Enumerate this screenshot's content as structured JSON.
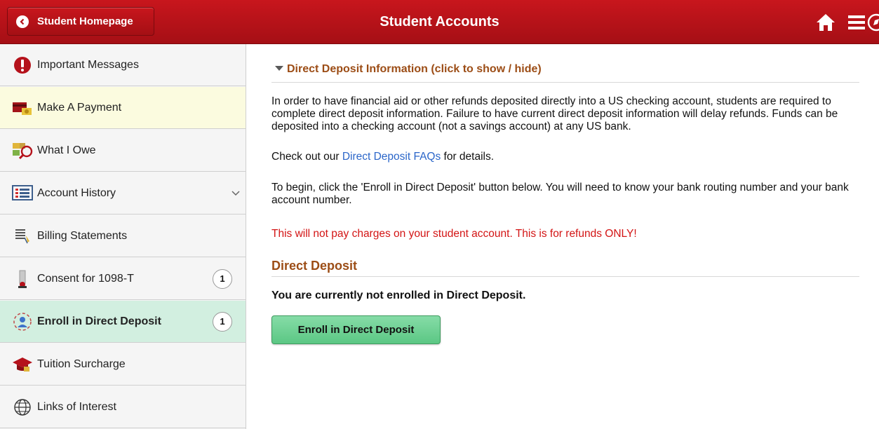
{
  "header": {
    "back_label": "Student Homepage",
    "title": "Student Accounts"
  },
  "sidebar": {
    "items": [
      {
        "label": "Important Messages",
        "icon": "alert-icon"
      },
      {
        "label": "Make A Payment",
        "icon": "payment-icon"
      },
      {
        "label": "What I Owe",
        "icon": "owe-icon"
      },
      {
        "label": "Account History",
        "icon": "history-icon"
      },
      {
        "label": "Billing Statements",
        "icon": "statement-icon"
      },
      {
        "label": "Consent for 1098-T",
        "icon": "consent-icon",
        "badge": "1"
      },
      {
        "label": "Enroll in Direct Deposit",
        "icon": "direct-deposit-icon",
        "badge": "1"
      },
      {
        "label": "Tuition Surcharge",
        "icon": "graduation-cap-icon"
      },
      {
        "label": "Links of Interest",
        "icon": "globe-icon"
      }
    ]
  },
  "main": {
    "info_section_title": "Direct Deposit Information (click to show / hide)",
    "paragraph1": "In order to have financial aid or other refunds deposited directly into a US checking account, students are required to complete direct deposit information. Failure to have current direct deposit information will delay refunds. Funds can be deposited into a checking account (not a savings account) at any US bank.",
    "paragraph2_prefix": "Check out our ",
    "paragraph2_link": "Direct Deposit FAQs",
    "paragraph2_suffix": " for details.",
    "paragraph3": "To begin, click the 'Enroll in Direct Deposit' button below. You will need to know your bank routing number and your bank account number.",
    "warning": "This will not pay charges on your student account. This is for refunds ONLY!",
    "deposit_section_title": "Direct Deposit",
    "status": "You are currently not enrolled in Direct Deposit.",
    "enroll_button": "Enroll in Direct Deposit"
  },
  "colors": {
    "header_red": "#b5121b",
    "section_title": "#9c4d16",
    "warning": "#d31414",
    "link": "#2b66c9",
    "active_highlight": "#d2efe0",
    "payment_highlight": "#fbfbdf",
    "button_green": "#6fd193"
  }
}
